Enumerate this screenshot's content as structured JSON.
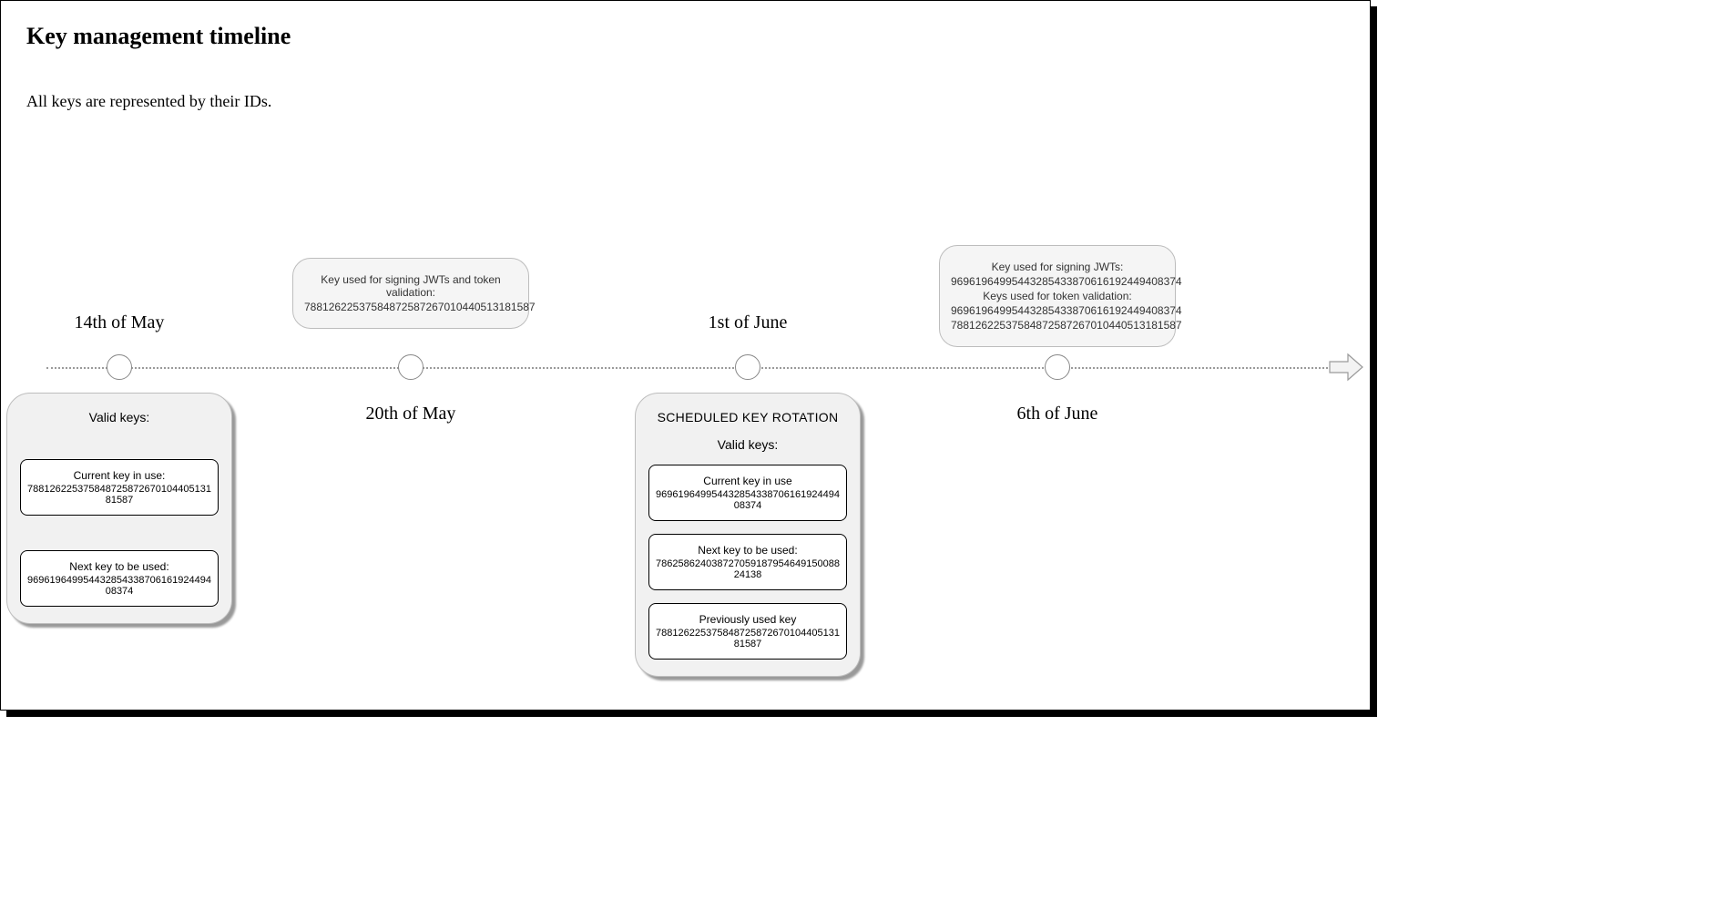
{
  "title": "Key management timeline",
  "subtitle": "All keys are represented by their IDs.",
  "events": [
    {
      "date": "14th of May"
    },
    {
      "date": "20th of May"
    },
    {
      "date": "1st of June"
    },
    {
      "date": "6th of June"
    }
  ],
  "box_may20": {
    "line1": "Key used for signing JWTs and token validation:",
    "key1": "78812622537584872587267010440513181587"
  },
  "box_jun6": {
    "line1": "Key used for signing JWTs:",
    "key1": "96961964995443285433870616192449408374",
    "line2": "Keys used for token validation:",
    "key2": "96961964995443285433870616192449408374",
    "key3": "78812622537584872587267010440513181587"
  },
  "card_may14": {
    "heading": "Valid keys:",
    "slot1_label": "Current key in use:",
    "slot1_value": "78812622537584872587267010440513181587",
    "slot2_label": "Next key to be used:",
    "slot2_value": "96961964995443285433870616192449408374"
  },
  "card_jun1": {
    "top": "SCHEDULED KEY ROTATION",
    "heading": "Valid keys:",
    "slot1_label": "Current key in use",
    "slot1_value": "96961964995443285433870616192449408374",
    "slot2_label": "Next key to be used:",
    "slot2_value": "78625862403872705918795464915008824138",
    "slot3_label": "Previously used key",
    "slot3_value": "78812622537584872587267010440513181587"
  }
}
